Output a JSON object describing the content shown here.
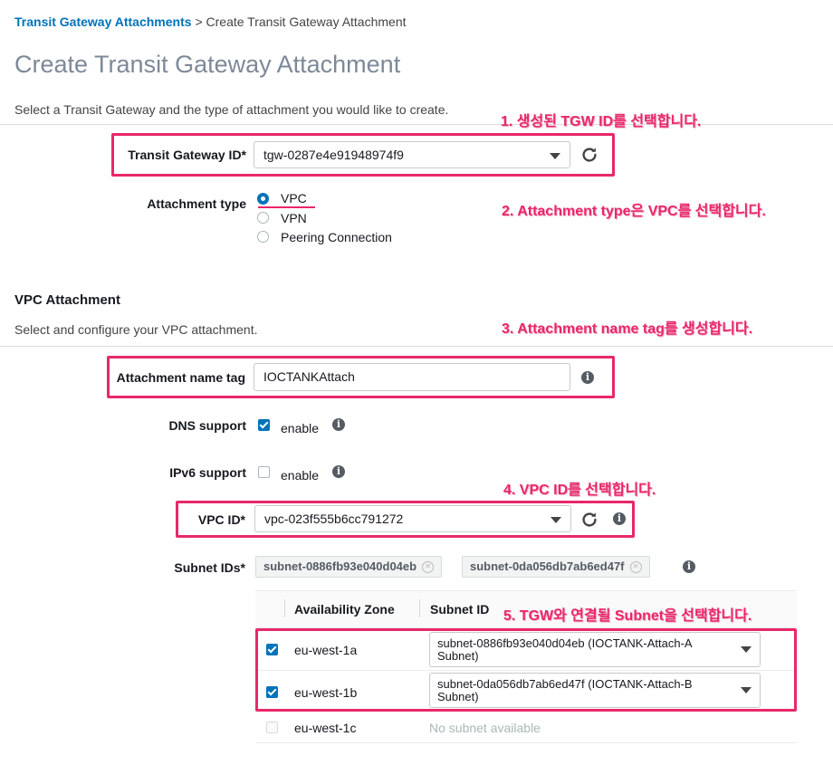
{
  "breadcrumb": {
    "link": "Transit Gateway Attachments",
    "separator": ">",
    "current": "Create Transit Gateway Attachment"
  },
  "page_title": "Create Transit Gateway Attachment",
  "intro": "Select a Transit Gateway and the type of attachment you would like to create.",
  "tgw": {
    "label": "Transit Gateway ID*",
    "value": "tgw-0287e4e91948974f9"
  },
  "attachment_type": {
    "label": "Attachment type",
    "options": [
      "VPC",
      "VPN",
      "Peering Connection"
    ],
    "selected": "VPC"
  },
  "vpc_section": {
    "title": "VPC Attachment",
    "desc": "Select and configure your VPC attachment."
  },
  "name_tag": {
    "label": "Attachment name tag",
    "value": "IOCTANKAttach"
  },
  "dns": {
    "label": "DNS support",
    "checkbox_label": "enable",
    "checked": true
  },
  "ipv6": {
    "label": "IPv6 support",
    "checkbox_label": "enable",
    "checked": false
  },
  "vpc": {
    "label": "VPC ID*",
    "value": "vpc-023f555b6cc791272"
  },
  "subnets": {
    "label": "Subnet IDs*",
    "tokens": [
      "subnet-0886fb93e040d04eb",
      "subnet-0da056db7ab6ed47f"
    ],
    "table": {
      "headers": [
        "Availability Zone",
        "Subnet ID"
      ],
      "rows": [
        {
          "az": "eu-west-1a",
          "checked": true,
          "subnet_line1": "subnet-0886fb93e040d04eb (IOCTANK-Attach-A",
          "subnet_line2": "Subnet)"
        },
        {
          "az": "eu-west-1b",
          "checked": true,
          "subnet_line1": "subnet-0da056db7ab6ed47f (IOCTANK-Attach-B",
          "subnet_line2": "Subnet)"
        },
        {
          "az": "eu-west-1c",
          "checked": false,
          "none_text": "No subnet available"
        }
      ]
    }
  },
  "annotations": {
    "a1": "1. 생성된 TGW ID를 선택합니다.",
    "a2": "2. Attachment type은 VPC를 선택합니다.",
    "a3": "3. Attachment name tag를 생성합니다.",
    "a4": "4. VPC ID를 선택합니다.",
    "a5": "5. TGW와 연결될 Subnet을 선택합니다."
  },
  "colors": {
    "accent": "#0073bb",
    "annotation": "#e8286a",
    "title_gray": "#7d8998"
  },
  "icons": {
    "refresh": "refresh-icon",
    "info": "info-icon",
    "caret": "caret-down-icon",
    "remove": "token-remove-icon"
  }
}
